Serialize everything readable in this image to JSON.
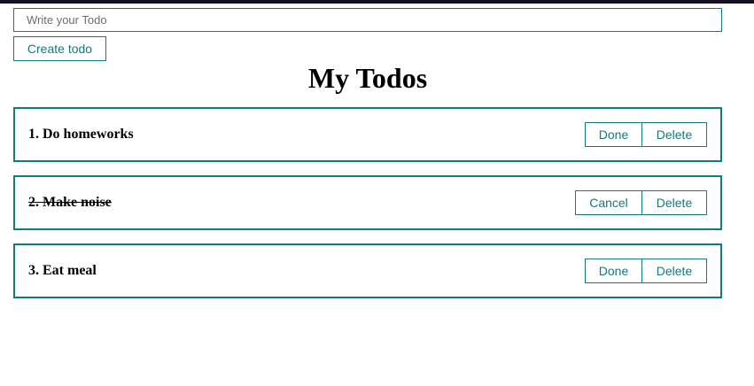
{
  "form": {
    "input_value": "",
    "input_placeholder": "Write your Todo",
    "create_label": "Create todo"
  },
  "title": "My Todos",
  "todos": [
    {
      "text": "1. Do homeworks",
      "completed": false,
      "toggle_label": "Done",
      "delete_label": "Delete"
    },
    {
      "text": "2. Make noise",
      "completed": true,
      "toggle_label": "Cancel",
      "delete_label": "Delete"
    },
    {
      "text": "3. Eat meal",
      "completed": false,
      "toggle_label": "Done",
      "delete_label": "Delete"
    }
  ],
  "colors": {
    "accent": "#137a7a",
    "top_bar": "#1a1024"
  }
}
